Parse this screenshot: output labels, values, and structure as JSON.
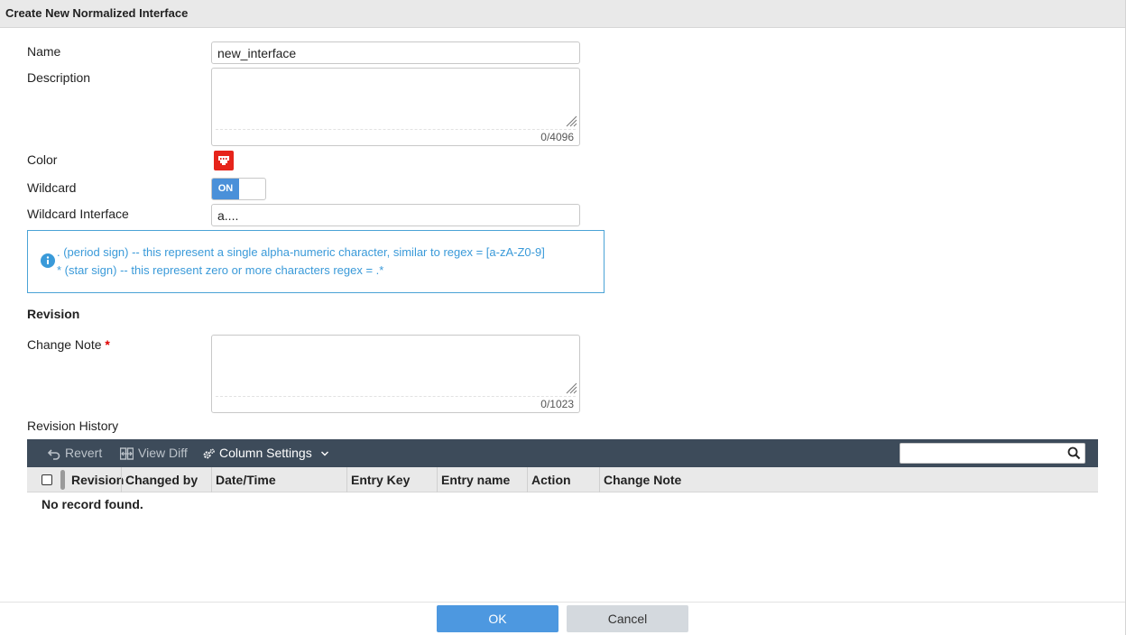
{
  "dialog": {
    "title": "Create New Normalized Interface"
  },
  "form": {
    "name_label": "Name",
    "name_value": "new_interface",
    "description_label": "Description",
    "description_value": "",
    "description_counter": "0/4096",
    "color_label": "Color",
    "color_value": "#e6241b",
    "wildcard_label": "Wildcard",
    "wildcard_toggle": "ON",
    "wildcard_interface_label": "Wildcard Interface",
    "wildcard_interface_value": "a...."
  },
  "info": {
    "line1": ". (period sign) -- this represent a single alpha-numeric character, similar to regex = [a-zA-Z0-9]",
    "line2": "* (star sign) -- this represent zero or more characters regex = .*"
  },
  "revision": {
    "section_title": "Revision",
    "change_note_label": "Change Note",
    "change_note_required": "*",
    "change_note_value": "",
    "change_note_counter": "0/1023",
    "history_label": "Revision History"
  },
  "toolbar": {
    "revert": "Revert",
    "view_diff": "View Diff",
    "column_settings": "Column Settings",
    "search_value": ""
  },
  "table": {
    "columns": [
      "Revision",
      "Changed by",
      "Date/Time",
      "Entry Key",
      "Entry name",
      "Action",
      "Change Note"
    ],
    "empty_message": "No record found."
  },
  "footer": {
    "ok": "OK",
    "cancel": "Cancel"
  }
}
